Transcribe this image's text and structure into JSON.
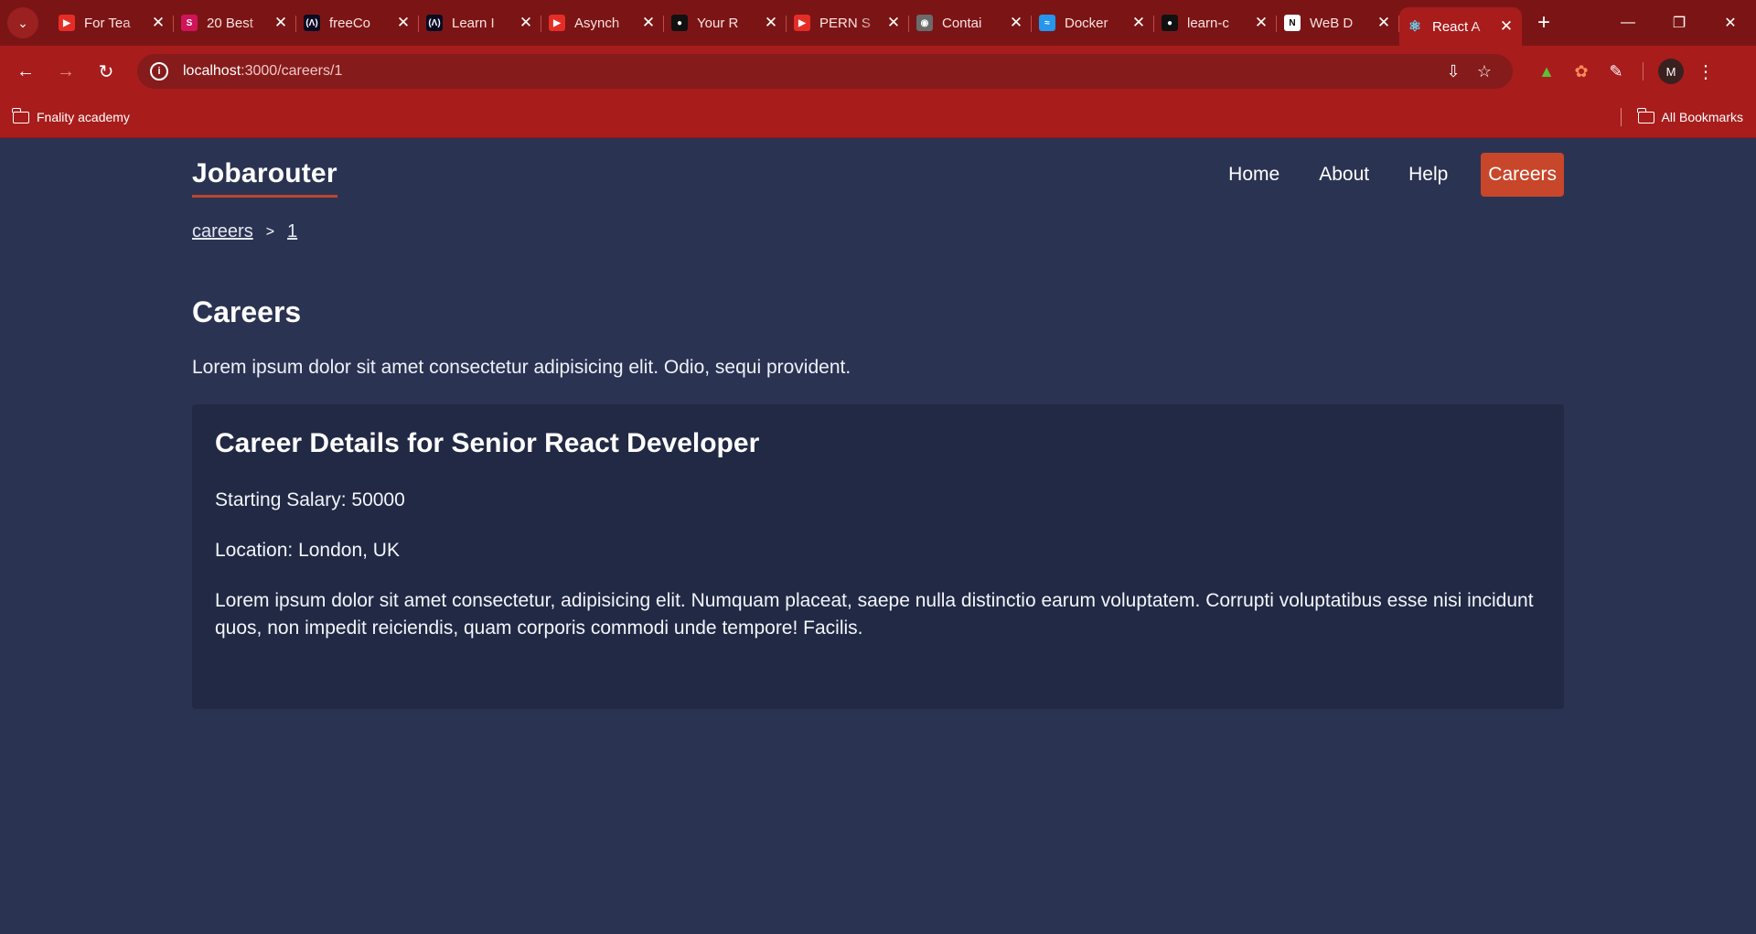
{
  "browser": {
    "tabs": [
      {
        "label": "For Tea",
        "favicon": "youtube-icon",
        "color": "#e52d27"
      },
      {
        "label": "20 Best",
        "favicon": "s-icon",
        "color": "#d1145a"
      },
      {
        "label": "freeCo",
        "favicon": "freecodecamp-icon",
        "color": "#0a0a23"
      },
      {
        "label": "Learn I",
        "favicon": "freecodecamp-icon",
        "color": "#0a0a23"
      },
      {
        "label": "Asynch",
        "favicon": "youtube-icon",
        "color": "#e52d27"
      },
      {
        "label": "Your R",
        "favicon": "github-icon",
        "color": "#111111"
      },
      {
        "label": "PERN S",
        "favicon": "youtube-icon",
        "color": "#e52d27"
      },
      {
        "label": "Contai",
        "favicon": "globe-icon",
        "color": "#6b6b6b"
      },
      {
        "label": "Docker",
        "favicon": "docker-icon",
        "color": "#2496ed"
      },
      {
        "label": "learn-c",
        "favicon": "github-icon",
        "color": "#111111"
      },
      {
        "label": "WeB D",
        "favicon": "notion-icon",
        "color": "#ffffff"
      },
      {
        "label": "React A",
        "favicon": "react-icon",
        "color": "#61dafb",
        "active": true
      }
    ],
    "address": {
      "host": "localhost",
      "path": ":3000/careers/1"
    },
    "bookmarks": {
      "folder": "Fnality academy",
      "all": "All Bookmarks"
    },
    "profile_initial": "M"
  },
  "site": {
    "brand": "Jobarouter",
    "nav": {
      "home": "Home",
      "about": "About",
      "help": "Help",
      "careers": "Careers"
    },
    "breadcrumb": {
      "first": "careers",
      "separator": ">",
      "second": "1"
    },
    "title": "Careers",
    "intro": "Lorem ipsum dolor sit amet consectetur adipisicing elit. Odio, sequi provident.",
    "career": {
      "heading": "Career Details for Senior React Developer",
      "salary": "Starting Salary: 50000",
      "location": "Location: London, UK",
      "description": "Lorem ipsum dolor sit amet consectetur, adipisicing elit. Numquam placeat, saepe nulla distinctio earum voluptatem. Corrupti voluptatibus esse nisi incidunt quos, non impedit reiciendis, quam corporis commodi unde tempore! Facilis."
    }
  },
  "colors": {
    "accent": "#c8462a",
    "page_bg": "#2b3352",
    "card_bg": "#212944",
    "chrome": "#a81c1c"
  }
}
